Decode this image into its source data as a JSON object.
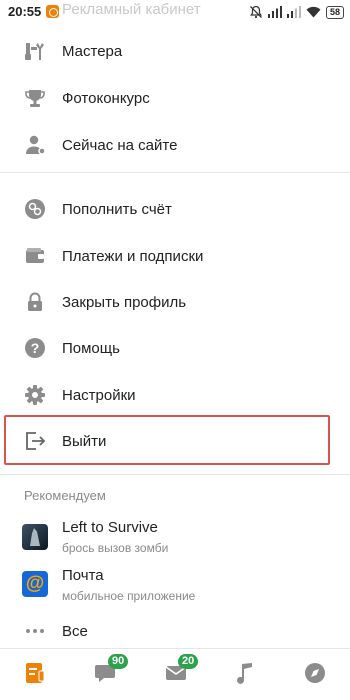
{
  "status_bar": {
    "time": "20:55",
    "faded_title": "Рекламный кабинет",
    "battery": "58"
  },
  "menu": {
    "items": [
      {
        "label": "Мастера",
        "icon": "tools-icon"
      },
      {
        "label": "Фотоконкурс",
        "icon": "trophy-icon"
      },
      {
        "label": "Сейчас на сайте",
        "icon": "person-online-icon"
      },
      {
        "label": "Пополнить счёт",
        "icon": "coins-icon"
      },
      {
        "label": "Платежи и подписки",
        "icon": "wallet-icon"
      },
      {
        "label": "Закрыть профиль",
        "icon": "lock-icon"
      },
      {
        "label": "Помощь",
        "icon": "help-icon"
      },
      {
        "label": "Настройки",
        "icon": "gear-icon"
      },
      {
        "label": "Выйти",
        "icon": "logout-icon"
      }
    ]
  },
  "recommend": {
    "title": "Рекомендуем",
    "apps": [
      {
        "name": "Left to Survive",
        "subtitle": "брось вызов зомби"
      },
      {
        "name": "Почта",
        "subtitle": "мобильное приложение",
        "icon_glyph": "@"
      }
    ],
    "all_label": "Все"
  },
  "bottom_nav": {
    "discussions_badge": "90",
    "messages_badge": "20"
  },
  "colors": {
    "accent": "#ee8208",
    "highlight": "#d9534f",
    "badge": "#2ca24a",
    "icon_gray": "#8c8c8c"
  }
}
